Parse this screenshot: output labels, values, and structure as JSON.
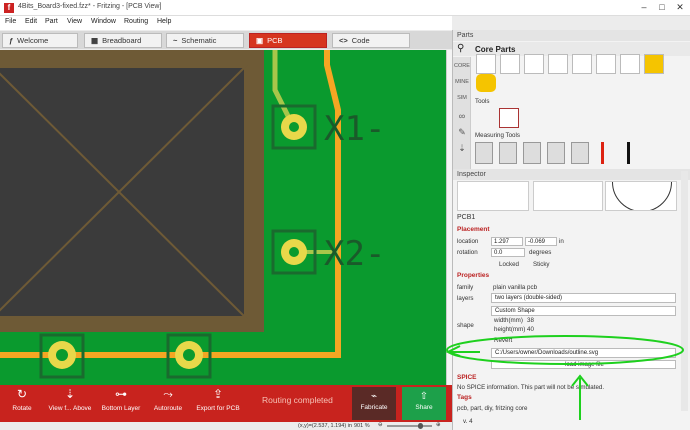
{
  "window": {
    "title": "4Bits_Board3-fixed.fzz* - Fritzing - [PCB View]"
  },
  "menu": [
    "File",
    "Edit",
    "Part",
    "View",
    "Window",
    "Routing",
    "Help"
  ],
  "tabs": [
    {
      "label": "Welcome",
      "icon": "welcome-icon",
      "active": false
    },
    {
      "label": "Breadboard",
      "icon": "breadboard-icon",
      "active": false
    },
    {
      "label": "Schematic",
      "icon": "schematic-icon",
      "active": false
    },
    {
      "label": "PCB",
      "icon": "pcb-icon",
      "active": true
    },
    {
      "label": "Code",
      "icon": "code-icon",
      "active": false
    }
  ],
  "canvas": {
    "labels": [
      "X1-",
      "X2-"
    ],
    "colors": {
      "board": "#0a9a2e",
      "trace": "#f5a623",
      "pad": "#e8d84a",
      "grid": "#3a3a3a"
    }
  },
  "toolbar": {
    "rotate": "Rotate",
    "view_from_above": "View f... Above",
    "bottom_layer": "Bottom Layer",
    "autoroute": "Autoroute",
    "export": "Export for PCB",
    "status": "Routing completed",
    "fabricate": "Fabricate",
    "share": "Share"
  },
  "statusbar": {
    "coords": "(x,y)=(2.537, 1.194) in",
    "zoom": "901 %"
  },
  "parts": {
    "header": "Parts",
    "bin_title": "Core Parts",
    "bins": [
      "CORE",
      "MINE",
      "SIM"
    ],
    "tools_label": "Tools",
    "measuring_label": "Measuring Tools"
  },
  "inspector": {
    "header": "Inspector",
    "part_title": "PCB1",
    "placement_header": "Placement",
    "location_label": "location",
    "location_x": "1.297",
    "location_y": "-0.069",
    "location_unit": "in",
    "rotation_label": "rotation",
    "rotation_value": "0.0",
    "rotation_unit": "degrees",
    "locked": "Locked",
    "sticky": "Sticky",
    "properties_header": "Properties",
    "family_label": "family",
    "family_value": "plain vanilla pcb",
    "layers_label": "layers",
    "layers_value": "two layers (double-sided)",
    "shape_label": "shape",
    "custom_shape": "Custom Shape",
    "width_label": "width(mm)",
    "width_value": "38",
    "height_label": "height(mm)",
    "height_value": "40",
    "revert": "Revert",
    "path_value": "C:/Users/owner/Downloads/outline.svg",
    "load_image": "load image file",
    "spice_header": "SPICE",
    "spice_text": "No SPICE information. This part will not be simulated.",
    "tags_header": "Tags",
    "tags_value": "pcb, part, diy, fritzing core",
    "version": "v. 4"
  },
  "annotation_color": "#1ed01e"
}
